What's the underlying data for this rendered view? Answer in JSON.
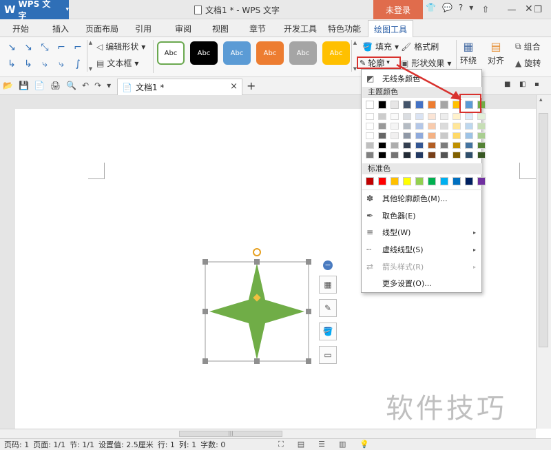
{
  "titlebar": {
    "app_name": "WPS 文字",
    "logo": "W",
    "app_caret": "▾",
    "doc_title": "文档1 * - WPS 文字",
    "login_label": "未登录",
    "icons": [
      "shirt-icon",
      "chat-icon",
      "help-icon",
      "upload-icon"
    ],
    "help_label": "?",
    "window_controls": {
      "minimize": "—",
      "restore": "❐",
      "close": "✕"
    }
  },
  "tabs": [
    "开始",
    "插入",
    "页面布局",
    "引用",
    "审阅",
    "视图",
    "章节",
    "开发工具",
    "特色功能"
  ],
  "active_tab": "绘图工具",
  "ribbon": {
    "edit_shape": "编辑形状",
    "text_box": "文本框",
    "style_label": "Abc",
    "styles": [
      {
        "bg": "#ffffff",
        "fg": "#222222",
        "border": "#6aa84f"
      },
      {
        "bg": "#000000",
        "fg": "#ffffff",
        "border": "#000000"
      },
      {
        "bg": "#5b9bd5",
        "fg": "#ffffff",
        "border": "#5b9bd5"
      },
      {
        "bg": "#ed7d31",
        "fg": "#ffffff",
        "border": "#ed7d31"
      },
      {
        "bg": "#a5a5a5",
        "fg": "#ffffff",
        "border": "#a5a5a5"
      },
      {
        "bg": "#ffc000",
        "fg": "#ffffff",
        "border": "#ffc000"
      }
    ],
    "fill": "填充",
    "format_painter": "格式刷",
    "outline": "轮廓",
    "shape_effects": "形状效果",
    "wrap": "环绕",
    "align": "对齐",
    "group": "组合",
    "rotate": "旋转"
  },
  "qbar": {
    "doc_tab": "文档1 *",
    "close": "×",
    "add": "+"
  },
  "menu": {
    "no_line_color": "无线条颜色",
    "theme_colors_header": "主题颜色",
    "standard_colors_header": "标准色",
    "more_outline_colors": "其他轮廓颜色(M)...",
    "eyedropper": "取色器(E)",
    "line_type": "线型(W)",
    "dash_type": "虚线线型(S)",
    "arrow_style": "箭头样式(R)",
    "more_settings": "更多设置(O)...",
    "theme_colors": [
      "#ffffff",
      "#000000",
      "#e7e6e6",
      "#44546a",
      "#4472c4",
      "#ed7d31",
      "#a5a5a5",
      "#ffc000",
      "#5b9bd5",
      "#70ad47"
    ],
    "standard_colors": [
      "#c00000",
      "#ff0000",
      "#ffc000",
      "#ffff00",
      "#92d050",
      "#00b050",
      "#00b0f0",
      "#0070c0",
      "#002060",
      "#7030a0"
    ]
  },
  "shape": {
    "fill_color": "#70ad47"
  },
  "statusbar": {
    "page_no": "页码: 1",
    "pages": "页面: 1/1",
    "section": "节: 1/1",
    "setting": "设置值: 2.5厘米",
    "row": "行: 1",
    "col": "列: 1",
    "words": "字数: 0"
  },
  "watermark": "软件技巧"
}
